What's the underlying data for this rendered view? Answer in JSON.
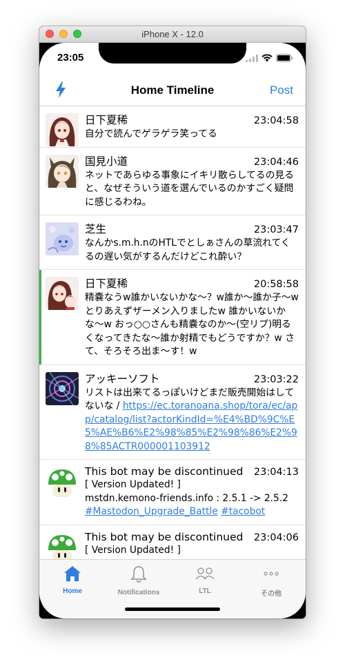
{
  "simulator": {
    "title": "iPhone X - 12.0"
  },
  "status_bar": {
    "time": "23:05"
  },
  "nav": {
    "title": "Home Timeline",
    "post_label": "Post",
    "left_icon": "bolt-icon"
  },
  "posts": [
    {
      "name": "日下夏稀",
      "time": "23:04:58",
      "body": "自分で読んでゲラゲラ笑ってる"
    },
    {
      "name": "国見小道",
      "time": "23:04:46",
      "body": "ネットであらゆる事象にイキリ散らしてるの見ると、なぜそういう道を選んでいるのかすごく疑問に感じるわね。"
    },
    {
      "name": "芝生",
      "time": "23:03:47",
      "body": "なんかs.m.h.nのHTLでとしぁさんの草流れてくるの遅い気がするんだけどこれ酔い？"
    },
    {
      "name": "日下夏稀",
      "time": "20:58:58",
      "body": "精嚢なうw誰かいないかな〜？w誰か〜誰か子〜w とりあえずザーメン入りましたw 誰かいないかな〜w おっ○○さんも精嚢なのか〜(空リプ)明るくなってきたな〜誰か射精でもどうですか？w さて、そろそろ出ま〜す！w"
    },
    {
      "name": "アッキーソフト",
      "time": "23:03:22",
      "body": "リストは出来てるっぽいけどまだ販売開始はしてないな / ",
      "link": "https://ec.toranoana.shop/tora/ec/app/catalog/list?actorKindId=%E4%BD%9C%E5%AE%B6%E2%98%85%E2%98%86%E2%98%85ACTR000001103912"
    },
    {
      "name": "This bot may be discontinued",
      "time": "23:04:13",
      "body": "[ Version Updated! ]",
      "body2": "mstdn.kemono-friends.info : 2.5.1 -> 2.5.2",
      "tag1": "#Mastodon_Upgrade_Battle",
      "tag2": "#tacobot"
    },
    {
      "name": "This bot may be discontinued",
      "time": "23:04:06",
      "body": "[ Version Updated! ]"
    }
  ],
  "tabs": [
    {
      "label": "Home",
      "icon": "home-icon",
      "active": true
    },
    {
      "label": "Notifications",
      "icon": "bell-icon",
      "active": false
    },
    {
      "label": "LTL",
      "icon": "people-icon",
      "active": false
    },
    {
      "label": "その他",
      "icon": "more-icon",
      "active": false
    }
  ],
  "colors": {
    "accent": "#2f7de1",
    "flag": "#3eb34f"
  }
}
